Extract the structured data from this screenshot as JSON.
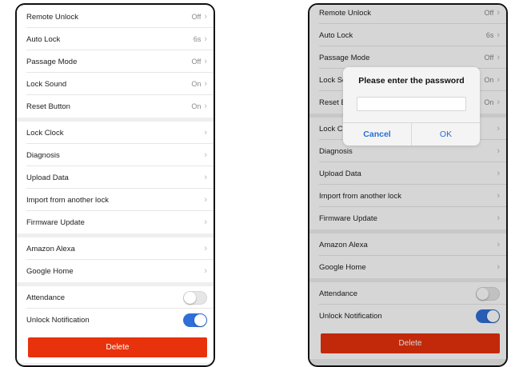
{
  "settings": {
    "group1": [
      {
        "label": "Remote Unlock",
        "value": "Off"
      },
      {
        "label": "Auto Lock",
        "value": "6s"
      },
      {
        "label": "Passage Mode",
        "value": "Off"
      },
      {
        "label": "Lock Sound",
        "value": "On"
      },
      {
        "label": "Reset Button",
        "value": "On"
      }
    ],
    "group2": [
      {
        "label": "Lock Clock"
      },
      {
        "label": "Diagnosis"
      },
      {
        "label": "Upload Data"
      },
      {
        "label": "Import from another lock"
      },
      {
        "label": "Firmware Update"
      }
    ],
    "group3": [
      {
        "label": "Amazon Alexa"
      },
      {
        "label": "Google Home"
      }
    ],
    "toggles": [
      {
        "label": "Attendance",
        "state": "off"
      },
      {
        "label": "Unlock Notification",
        "state": "on"
      }
    ],
    "delete_label": "Delete"
  },
  "dialog": {
    "title": "Please enter the password",
    "password_value": "",
    "cancel_label": "Cancel",
    "ok_label": "OK"
  },
  "colors": {
    "accent_blue": "#2f6fd8",
    "delete_red": "#e8320c",
    "dialog_button_blue": "#2a6fd6"
  },
  "icons": {
    "row_chevron": "chevron-right-icon"
  }
}
